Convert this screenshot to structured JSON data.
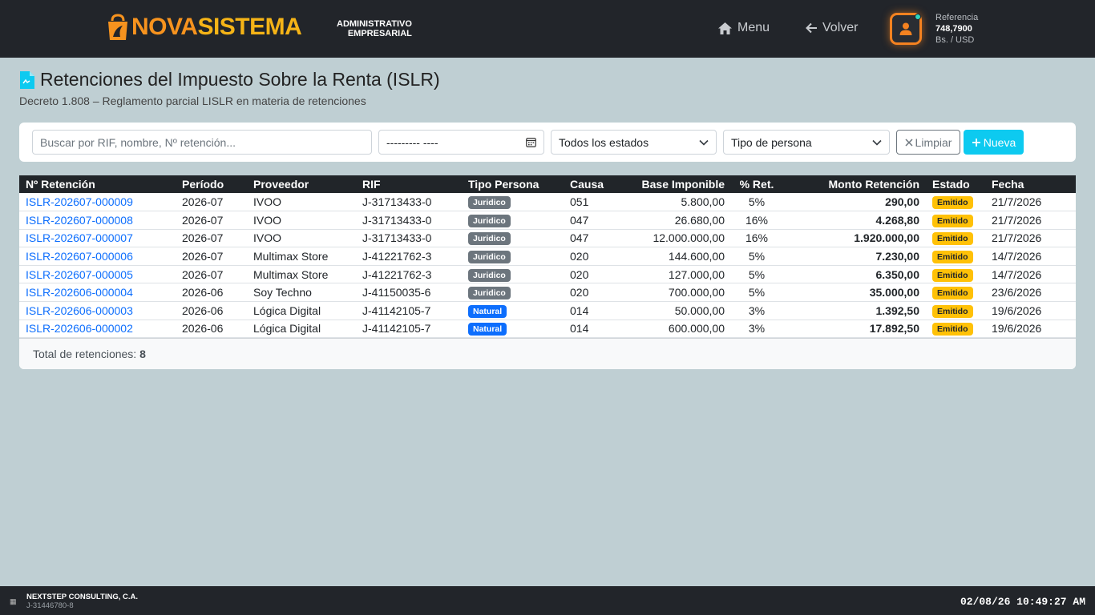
{
  "header": {
    "brand_part1": "NOVA",
    "brand_part2": "SISTEMA",
    "brand_sub1": "ADMINISTRATIVO",
    "brand_sub2": "EMPRESARIAL",
    "menu_label": "Menu",
    "back_label": "Volver",
    "ref_label": "Referencia",
    "ref_value": "748,7900",
    "ref_unit": "Bs. / USD"
  },
  "page": {
    "title": "Retenciones del Impuesto Sobre la Renta (ISLR)",
    "subtitle": "Decreto 1.808 – Reglamento parcial LISLR en materia de retenciones"
  },
  "filters": {
    "search_placeholder": "Buscar por RIF, nombre, Nº retención...",
    "date_value": "--------- ----",
    "state_value": "Todos los estados",
    "type_value": "Tipo de persona",
    "clear_label": "Limpiar",
    "new_label": "Nueva"
  },
  "table": {
    "columns": [
      "Nº Retención",
      "Período",
      "Proveedor",
      "RIF",
      "Tipo Persona",
      "Causa",
      "Base Imponible",
      "% Ret.",
      "Monto Retención",
      "Estado",
      "Fecha"
    ],
    "rows": [
      {
        "num": "ISLR-202607-000009",
        "period": "2026-07",
        "provider": "IVOO",
        "rif": "J-31713433-0",
        "type": "Juridico",
        "cause": "051",
        "base": "5.800,00",
        "pct": "5%",
        "amount": "290,00",
        "state": "Emitido",
        "date": "21/7/2026"
      },
      {
        "num": "ISLR-202607-000008",
        "period": "2026-07",
        "provider": "IVOO",
        "rif": "J-31713433-0",
        "type": "Juridico",
        "cause": "047",
        "base": "26.680,00",
        "pct": "16%",
        "amount": "4.268,80",
        "state": "Emitido",
        "date": "21/7/2026"
      },
      {
        "num": "ISLR-202607-000007",
        "period": "2026-07",
        "provider": "IVOO",
        "rif": "J-31713433-0",
        "type": "Juridico",
        "cause": "047",
        "base": "12.000.000,00",
        "pct": "16%",
        "amount": "1.920.000,00",
        "state": "Emitido",
        "date": "21/7/2026"
      },
      {
        "num": "ISLR-202607-000006",
        "period": "2026-07",
        "provider": "Multimax Store",
        "rif": "J-41221762-3",
        "type": "Juridico",
        "cause": "020",
        "base": "144.600,00",
        "pct": "5%",
        "amount": "7.230,00",
        "state": "Emitido",
        "date": "14/7/2026"
      },
      {
        "num": "ISLR-202607-000005",
        "period": "2026-07",
        "provider": "Multimax Store",
        "rif": "J-41221762-3",
        "type": "Juridico",
        "cause": "020",
        "base": "127.000,00",
        "pct": "5%",
        "amount": "6.350,00",
        "state": "Emitido",
        "date": "14/7/2026"
      },
      {
        "num": "ISLR-202606-000004",
        "period": "2026-06",
        "provider": "Soy Techno",
        "rif": "J-41150035-6",
        "type": "Juridico",
        "cause": "020",
        "base": "700.000,00",
        "pct": "5%",
        "amount": "35.000,00",
        "state": "Emitido",
        "date": "23/6/2026"
      },
      {
        "num": "ISLR-202606-000003",
        "period": "2026-06",
        "provider": "Lógica Digital",
        "rif": "J-41142105-7",
        "type": "Natural",
        "cause": "014",
        "base": "50.000,00",
        "pct": "3%",
        "amount": "1.392,50",
        "state": "Emitido",
        "date": "19/6/2026"
      },
      {
        "num": "ISLR-202606-000002",
        "period": "2026-06",
        "provider": "Lógica Digital",
        "rif": "J-41142105-7",
        "type": "Natural",
        "cause": "014",
        "base": "600.000,00",
        "pct": "3%",
        "amount": "17.892,50",
        "state": "Emitido",
        "date": "19/6/2026"
      }
    ],
    "total_label": "Total de retenciones:",
    "total_value": "8"
  },
  "footer": {
    "company": "NEXTSTEP CONSULTING, C.A.",
    "rif": "J-31446780-8",
    "clock": "02/08/26 10:49:27 AM"
  },
  "colors": {
    "accent": "#0dcaf0",
    "brand_orange": "#f7931e",
    "link": "#0d6efd",
    "badge_warning": "#ffc107"
  }
}
